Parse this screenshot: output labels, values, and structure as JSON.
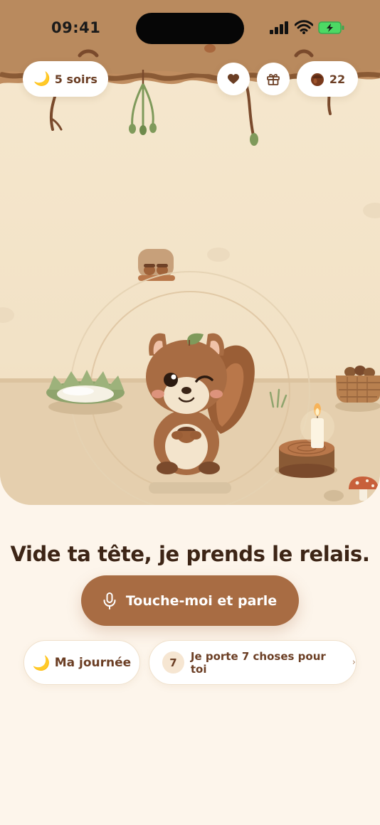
{
  "status_bar": {
    "time": "09:41"
  },
  "header": {
    "nights_icon": "moon-icon",
    "nights_label": "5 soirs",
    "heart_icon": "heart-icon",
    "gift_icon": "gift-icon",
    "acorn_icon": "acorn-icon",
    "acorn_count": "22"
  },
  "main": {
    "tagline": "Vide ta tête, je prends le relais.",
    "talk_button": {
      "icon": "microphone-icon",
      "label": "Touche-moi et parle"
    },
    "journal_chip": {
      "icon": "moon-icon",
      "label": "Ma journée"
    },
    "carry_chip": {
      "count": "7",
      "label": "Je porte 7 choses pour toi",
      "chevron": "›"
    }
  },
  "colors": {
    "accent": "#a86c43",
    "text_dark": "#3d2516",
    "text_brown": "#6b3e24",
    "background": "#fdf5eb"
  }
}
